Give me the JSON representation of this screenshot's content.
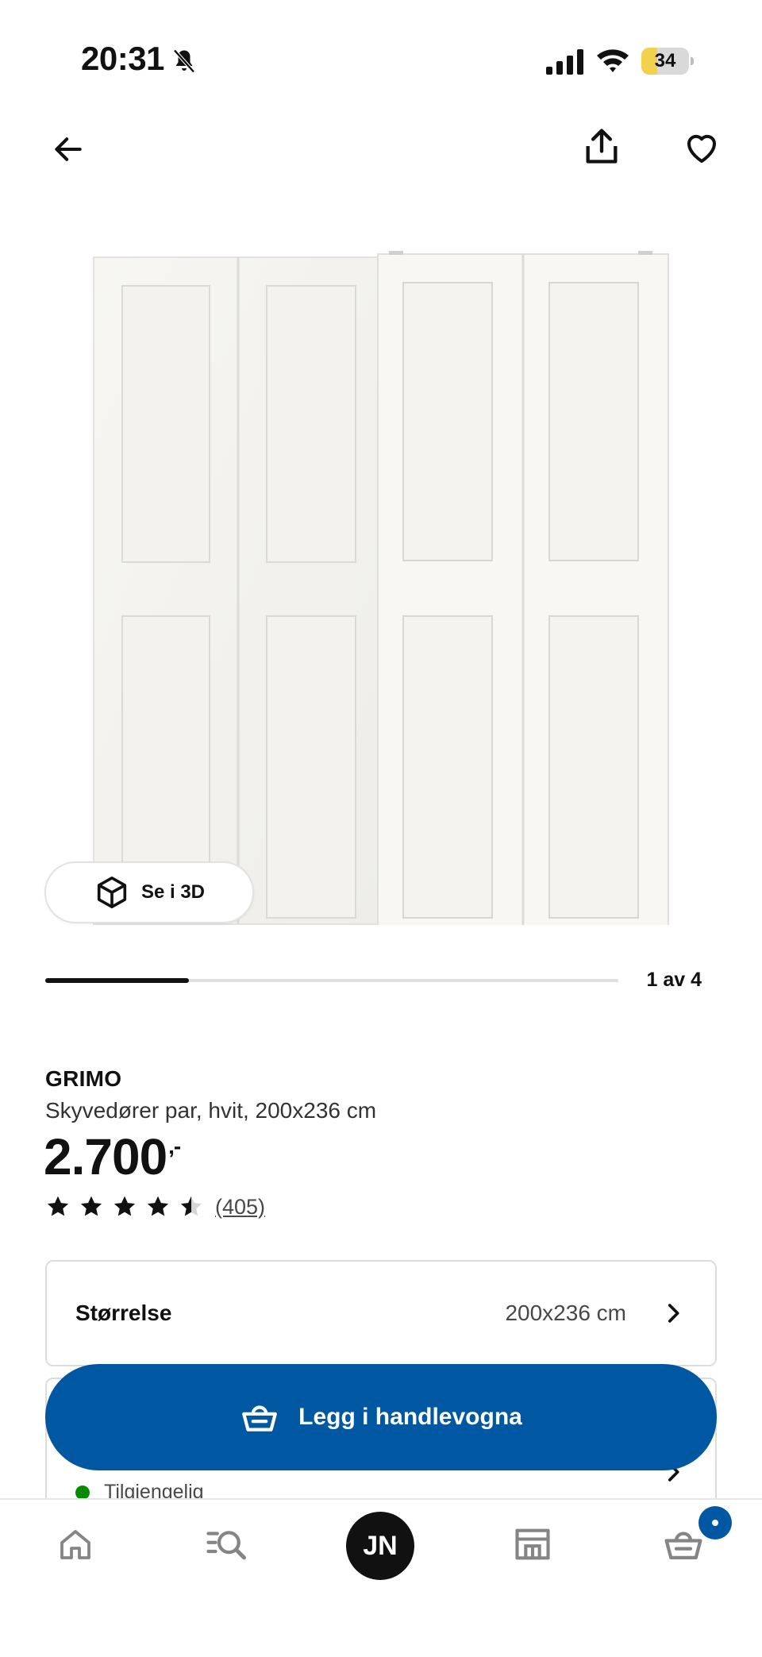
{
  "status_bar": {
    "time": "20:31",
    "battery_level": "34",
    "battery_fraction": 0.34,
    "icons": [
      "bell-slash-icon",
      "cellular-signal-icon",
      "wifi-icon",
      "battery-icon"
    ]
  },
  "top_nav": {
    "icons": [
      "arrow-left-icon",
      "share-icon",
      "heart-icon"
    ]
  },
  "gallery": {
    "view_3d_label": "Se i 3D",
    "counter": "1 av 4",
    "current": 1,
    "total": 4,
    "progress_fraction": 0.25
  },
  "product": {
    "name": "GRIMO",
    "description": "Skyvedører par, hvit, 200x236 cm",
    "price": "2.700",
    "price_suffix": ",-",
    "rating": 4.5,
    "review_count": "(405)"
  },
  "size_option": {
    "label": "Størrelse",
    "value": "200x236 cm"
  },
  "availability": {
    "status": "Tilgjengelig",
    "status_color": "#0a8a00"
  },
  "add_to_cart": {
    "label": "Legg i handlevogna"
  },
  "tab_bar": {
    "profile_initials": "JN",
    "icons": [
      "home-icon",
      "search-list-icon",
      "store-icon",
      "cart-icon"
    ]
  },
  "colors": {
    "accent": "#0058a3",
    "text": "#111111",
    "available": "#0a8a00"
  }
}
